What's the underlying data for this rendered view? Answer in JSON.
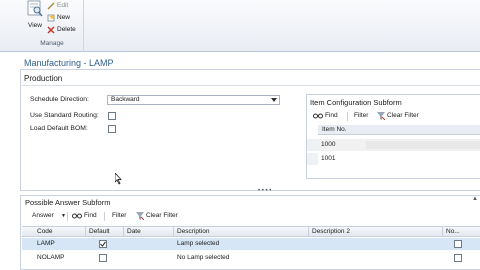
{
  "ribbon": {
    "view_label": "View",
    "edit_label": "Edit",
    "new_label": "New",
    "delete_label": "Delete",
    "group_label": "Manage"
  },
  "page": {
    "title": "Manufacturing - LAMP",
    "section": "Production",
    "fields": {
      "schedule_direction_label": "Schedule Direction:",
      "schedule_direction_value": "Backward",
      "use_standard_routing_label": "Use Standard Routing:",
      "load_default_bom_label": "Load Default BOM:"
    }
  },
  "item_config": {
    "title": "Item Configuration Subform",
    "find_label": "Find",
    "filter_label": "Filter",
    "clear_filter_label": "Clear Filter",
    "column_header": "Item No.",
    "rows": [
      "1000",
      "1001"
    ]
  },
  "possible_answer": {
    "title": "Possible Answer Subform",
    "answer_label": "Answer",
    "find_label": "Find",
    "filter_label": "Filter",
    "clear_filter_label": "Clear Filter",
    "columns": {
      "code": "Code",
      "default": "Default",
      "date": "Date",
      "description": "Description",
      "description2": "Description 2",
      "no": "No..."
    },
    "rows": [
      {
        "code": "LAMP",
        "default": true,
        "description": "Lamp selected"
      },
      {
        "code": "NOLAMP",
        "default": false,
        "description": "No Lamp selected"
      }
    ]
  },
  "colors": {
    "title_blue": "#2e5f8d",
    "selected_row": "#d6e6f6"
  }
}
